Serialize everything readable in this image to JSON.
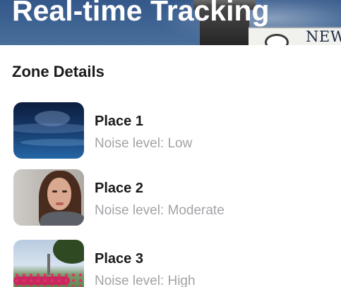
{
  "hero": {
    "title": "Real-time Tracking",
    "sign_text": "NEW"
  },
  "section": {
    "title": "Zone Details"
  },
  "zones": [
    {
      "name": "Place 1",
      "noise": "Noise level: Low",
      "thumbnail": "ocean-waves-image"
    },
    {
      "name": "Place 2",
      "noise": "Noise level: Moderate",
      "thumbnail": "woman-portrait-image"
    },
    {
      "name": "Place 3",
      "noise": "Noise level: High",
      "thumbnail": "flower-garden-image"
    }
  ],
  "colors": {
    "title_text": "#1a1a1a",
    "secondary_text": "#a3a3a8",
    "hero_sky": "#3e6493"
  }
}
